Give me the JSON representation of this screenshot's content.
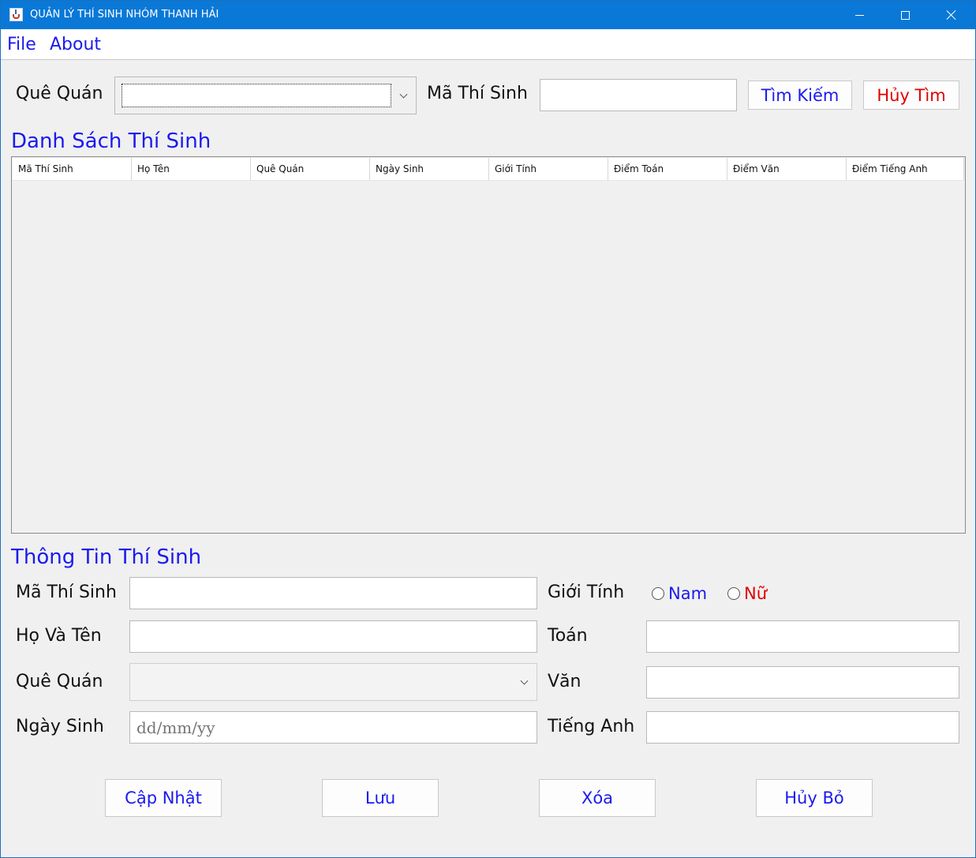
{
  "window": {
    "title": "QUẢN LÝ THÍ SINH NHÓM THANH HẢI"
  },
  "menu": {
    "items": [
      "File",
      "About"
    ]
  },
  "search": {
    "hometown_label": "Quê Quán",
    "hometown_value": "",
    "id_label": "Mã Thí Sinh",
    "id_value": "",
    "search_button": "Tìm Kiếm",
    "cancel_search_button": "Hủy Tìm"
  },
  "list": {
    "title": "Danh Sách Thí Sinh",
    "columns": [
      "Mã Thí Sinh",
      "Họ Tên",
      "Quê Quán",
      "Ngày Sinh",
      "Giới Tính",
      "Điểm Toán",
      "Điểm Văn",
      "Điểm Tiếng Anh"
    ],
    "rows": []
  },
  "form": {
    "title": "Thông Tin Thí Sinh",
    "id_label": "Mã Thí Sinh",
    "id_value": "",
    "name_label": "Họ Và Tên",
    "name_value": "",
    "hometown_label": "Quê Quán",
    "hometown_value": "",
    "dob_label": "Ngày Sinh",
    "dob_placeholder": "dd/mm/yy",
    "gender_label": "Giới Tính",
    "gender_male": "Nam",
    "gender_female": "Nữ",
    "math_label": "Toán",
    "math_value": "",
    "literature_label": "Văn",
    "literature_value": "",
    "english_label": "Tiếng Anh",
    "english_value": ""
  },
  "actions": {
    "update": "Cập Nhật",
    "save": "Lưu",
    "delete": "Xóa",
    "cancel": "Hủy Bỏ"
  },
  "colors": {
    "titlebar": "#0a78d7",
    "accent_blue": "#1a1af0",
    "accent_red": "#e10000"
  }
}
